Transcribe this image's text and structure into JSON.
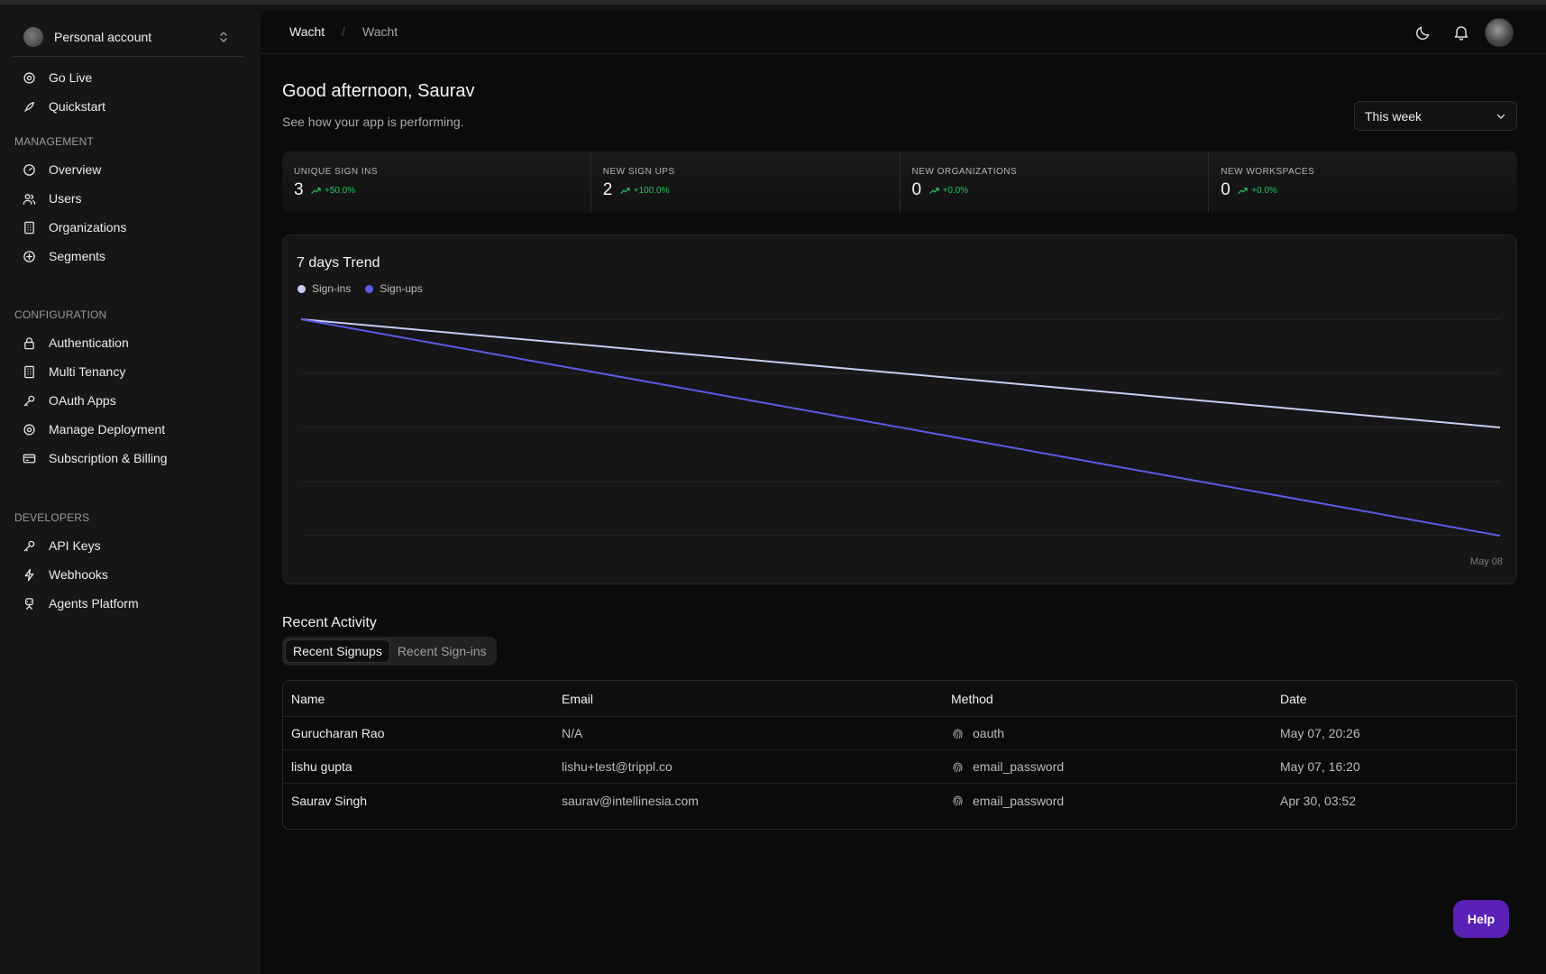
{
  "account": {
    "name": "Personal account"
  },
  "nav": {
    "top": [
      {
        "label": "Go Live",
        "icon": "gear-icon"
      },
      {
        "label": "Quickstart",
        "icon": "rocket-icon"
      }
    ],
    "management_title": "MANAGEMENT",
    "management": [
      {
        "label": "Overview",
        "icon": "gauge-icon"
      },
      {
        "label": "Users",
        "icon": "users-icon"
      },
      {
        "label": "Organizations",
        "icon": "building-icon"
      },
      {
        "label": "Segments",
        "icon": "plus-circle-icon"
      }
    ],
    "configuration_title": "CONFIGURATION",
    "configuration": [
      {
        "label": "Authentication",
        "icon": "lock-icon"
      },
      {
        "label": "Multi Tenancy",
        "icon": "building-icon"
      },
      {
        "label": "OAuth Apps",
        "icon": "key-icon"
      },
      {
        "label": "Manage Deployment",
        "icon": "gear-icon"
      },
      {
        "label": "Subscription & Billing",
        "icon": "credit-card-icon"
      }
    ],
    "developers_title": "DEVELOPERS",
    "developers": [
      {
        "label": "API Keys",
        "icon": "key-icon"
      },
      {
        "label": "Webhooks",
        "icon": "bolt-icon"
      },
      {
        "label": "Agents Platform",
        "icon": "bot-icon"
      }
    ]
  },
  "breadcrumb": {
    "first": "Wacht",
    "separator": "/",
    "second": "Wacht"
  },
  "header": {
    "greeting": "Good afternoon, Saurav",
    "subtitle": "See how your app is performing.",
    "range": "This week"
  },
  "stats": [
    {
      "label": "UNIQUE SIGN INS",
      "value": "3",
      "delta": "+50.0%"
    },
    {
      "label": "NEW SIGN UPS",
      "value": "2",
      "delta": "+100.0%"
    },
    {
      "label": "NEW ORGANIZATIONS",
      "value": "0",
      "delta": "+0.0%"
    },
    {
      "label": "NEW WORKSPACES",
      "value": "0",
      "delta": "+0.0%"
    }
  ],
  "chart_data": {
    "type": "line",
    "title": "7 days Trend",
    "x_tick_label": "May 08",
    "series": [
      {
        "name": "Sign-ins",
        "color": "#c7cdf5",
        "start": 1.0,
        "end": 0.5
      },
      {
        "name": "Sign-ups",
        "color": "#5b5bea",
        "start": 1.0,
        "end": 0.0
      }
    ],
    "grid": true,
    "legend": "top-left"
  },
  "recent": {
    "title": "Recent Activity",
    "tabs": [
      "Recent Signups",
      "Recent Sign-ins"
    ],
    "active_tab": 0,
    "columns": [
      "Name",
      "Email",
      "Method",
      "Date"
    ],
    "rows": [
      {
        "name": "Gurucharan Rao",
        "email": "N/A",
        "method": "oauth",
        "date": "May 07, 20:26"
      },
      {
        "name": "lishu gupta",
        "email": "lishu+test@trippl.co",
        "method": "email_password",
        "date": "May 07, 16:20"
      },
      {
        "name": "Saurav Singh",
        "email": "saurav@intellinesia.com",
        "method": "email_password",
        "date": "Apr 30, 03:52"
      }
    ]
  },
  "help": {
    "label": "Help"
  },
  "colors": {
    "accent": "#5b21b6",
    "positive": "#22c55e",
    "signins": "#c7cdf5",
    "signups": "#5b5bea"
  }
}
